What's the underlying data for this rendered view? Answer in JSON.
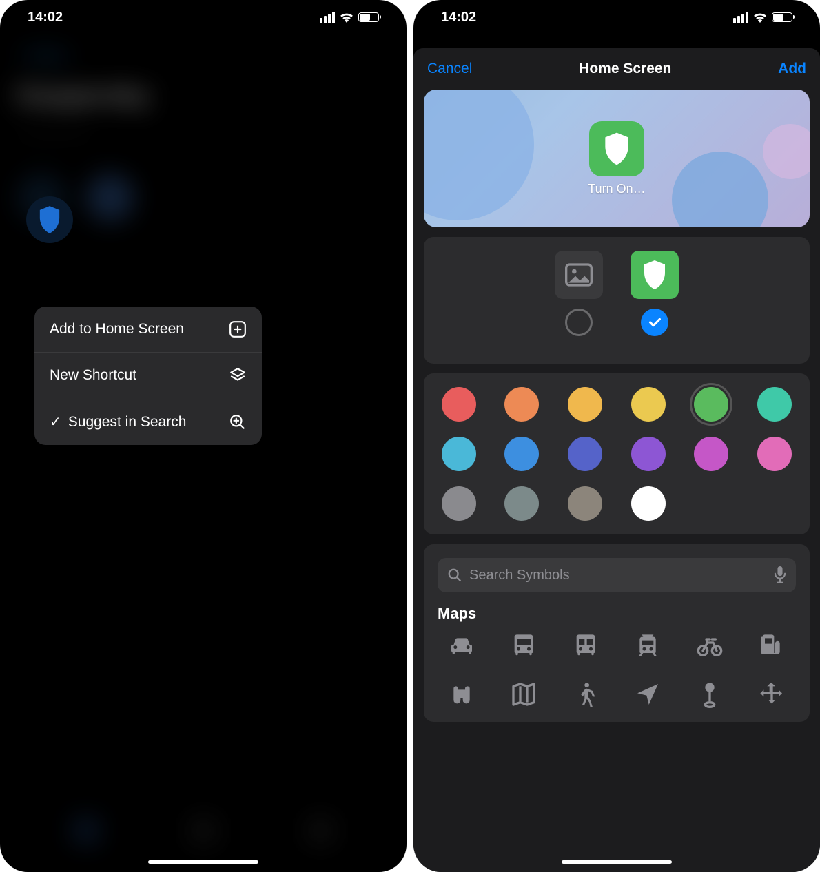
{
  "status": {
    "time": "14:02"
  },
  "left": {
    "bg_link": "‹ Gallery",
    "bg_title": "Kaspersky",
    "popup": {
      "add_home": "Add to Home Screen",
      "new_shortcut": "New Shortcut",
      "suggest": "Suggest in Search"
    }
  },
  "right": {
    "cancel": "Cancel",
    "title": "Home Screen",
    "add": "Add",
    "preview_label": "Turn On…",
    "colors": [
      {
        "hex": "#e85d5d",
        "name": "red"
      },
      {
        "hex": "#ed8a55",
        "name": "orange"
      },
      {
        "hex": "#f0b84d",
        "name": "amber"
      },
      {
        "hex": "#ebc950",
        "name": "yellow"
      },
      {
        "hex": "#5abb5e",
        "name": "green",
        "selected": true
      },
      {
        "hex": "#3fc9a8",
        "name": "teal"
      },
      {
        "hex": "#4ab8d8",
        "name": "cyan"
      },
      {
        "hex": "#3d8fe0",
        "name": "blue"
      },
      {
        "hex": "#5563c9",
        "name": "indigo"
      },
      {
        "hex": "#8d56d4",
        "name": "purple"
      },
      {
        "hex": "#c557c7",
        "name": "magenta"
      },
      {
        "hex": "#e26cb8",
        "name": "pink"
      },
      {
        "hex": "#8a8a8e",
        "name": "grey1"
      },
      {
        "hex": "#7c8a8a",
        "name": "grey2"
      },
      {
        "hex": "#8c857b",
        "name": "grey3"
      },
      {
        "hex": "#ffffff",
        "name": "white"
      }
    ],
    "search_placeholder": "Search Symbols",
    "symbol_section": "Maps",
    "symbols": [
      "car",
      "bus",
      "transit",
      "tram",
      "bicycle",
      "fuel",
      "binoculars",
      "map",
      "walk",
      "location",
      "pin",
      "move"
    ]
  }
}
